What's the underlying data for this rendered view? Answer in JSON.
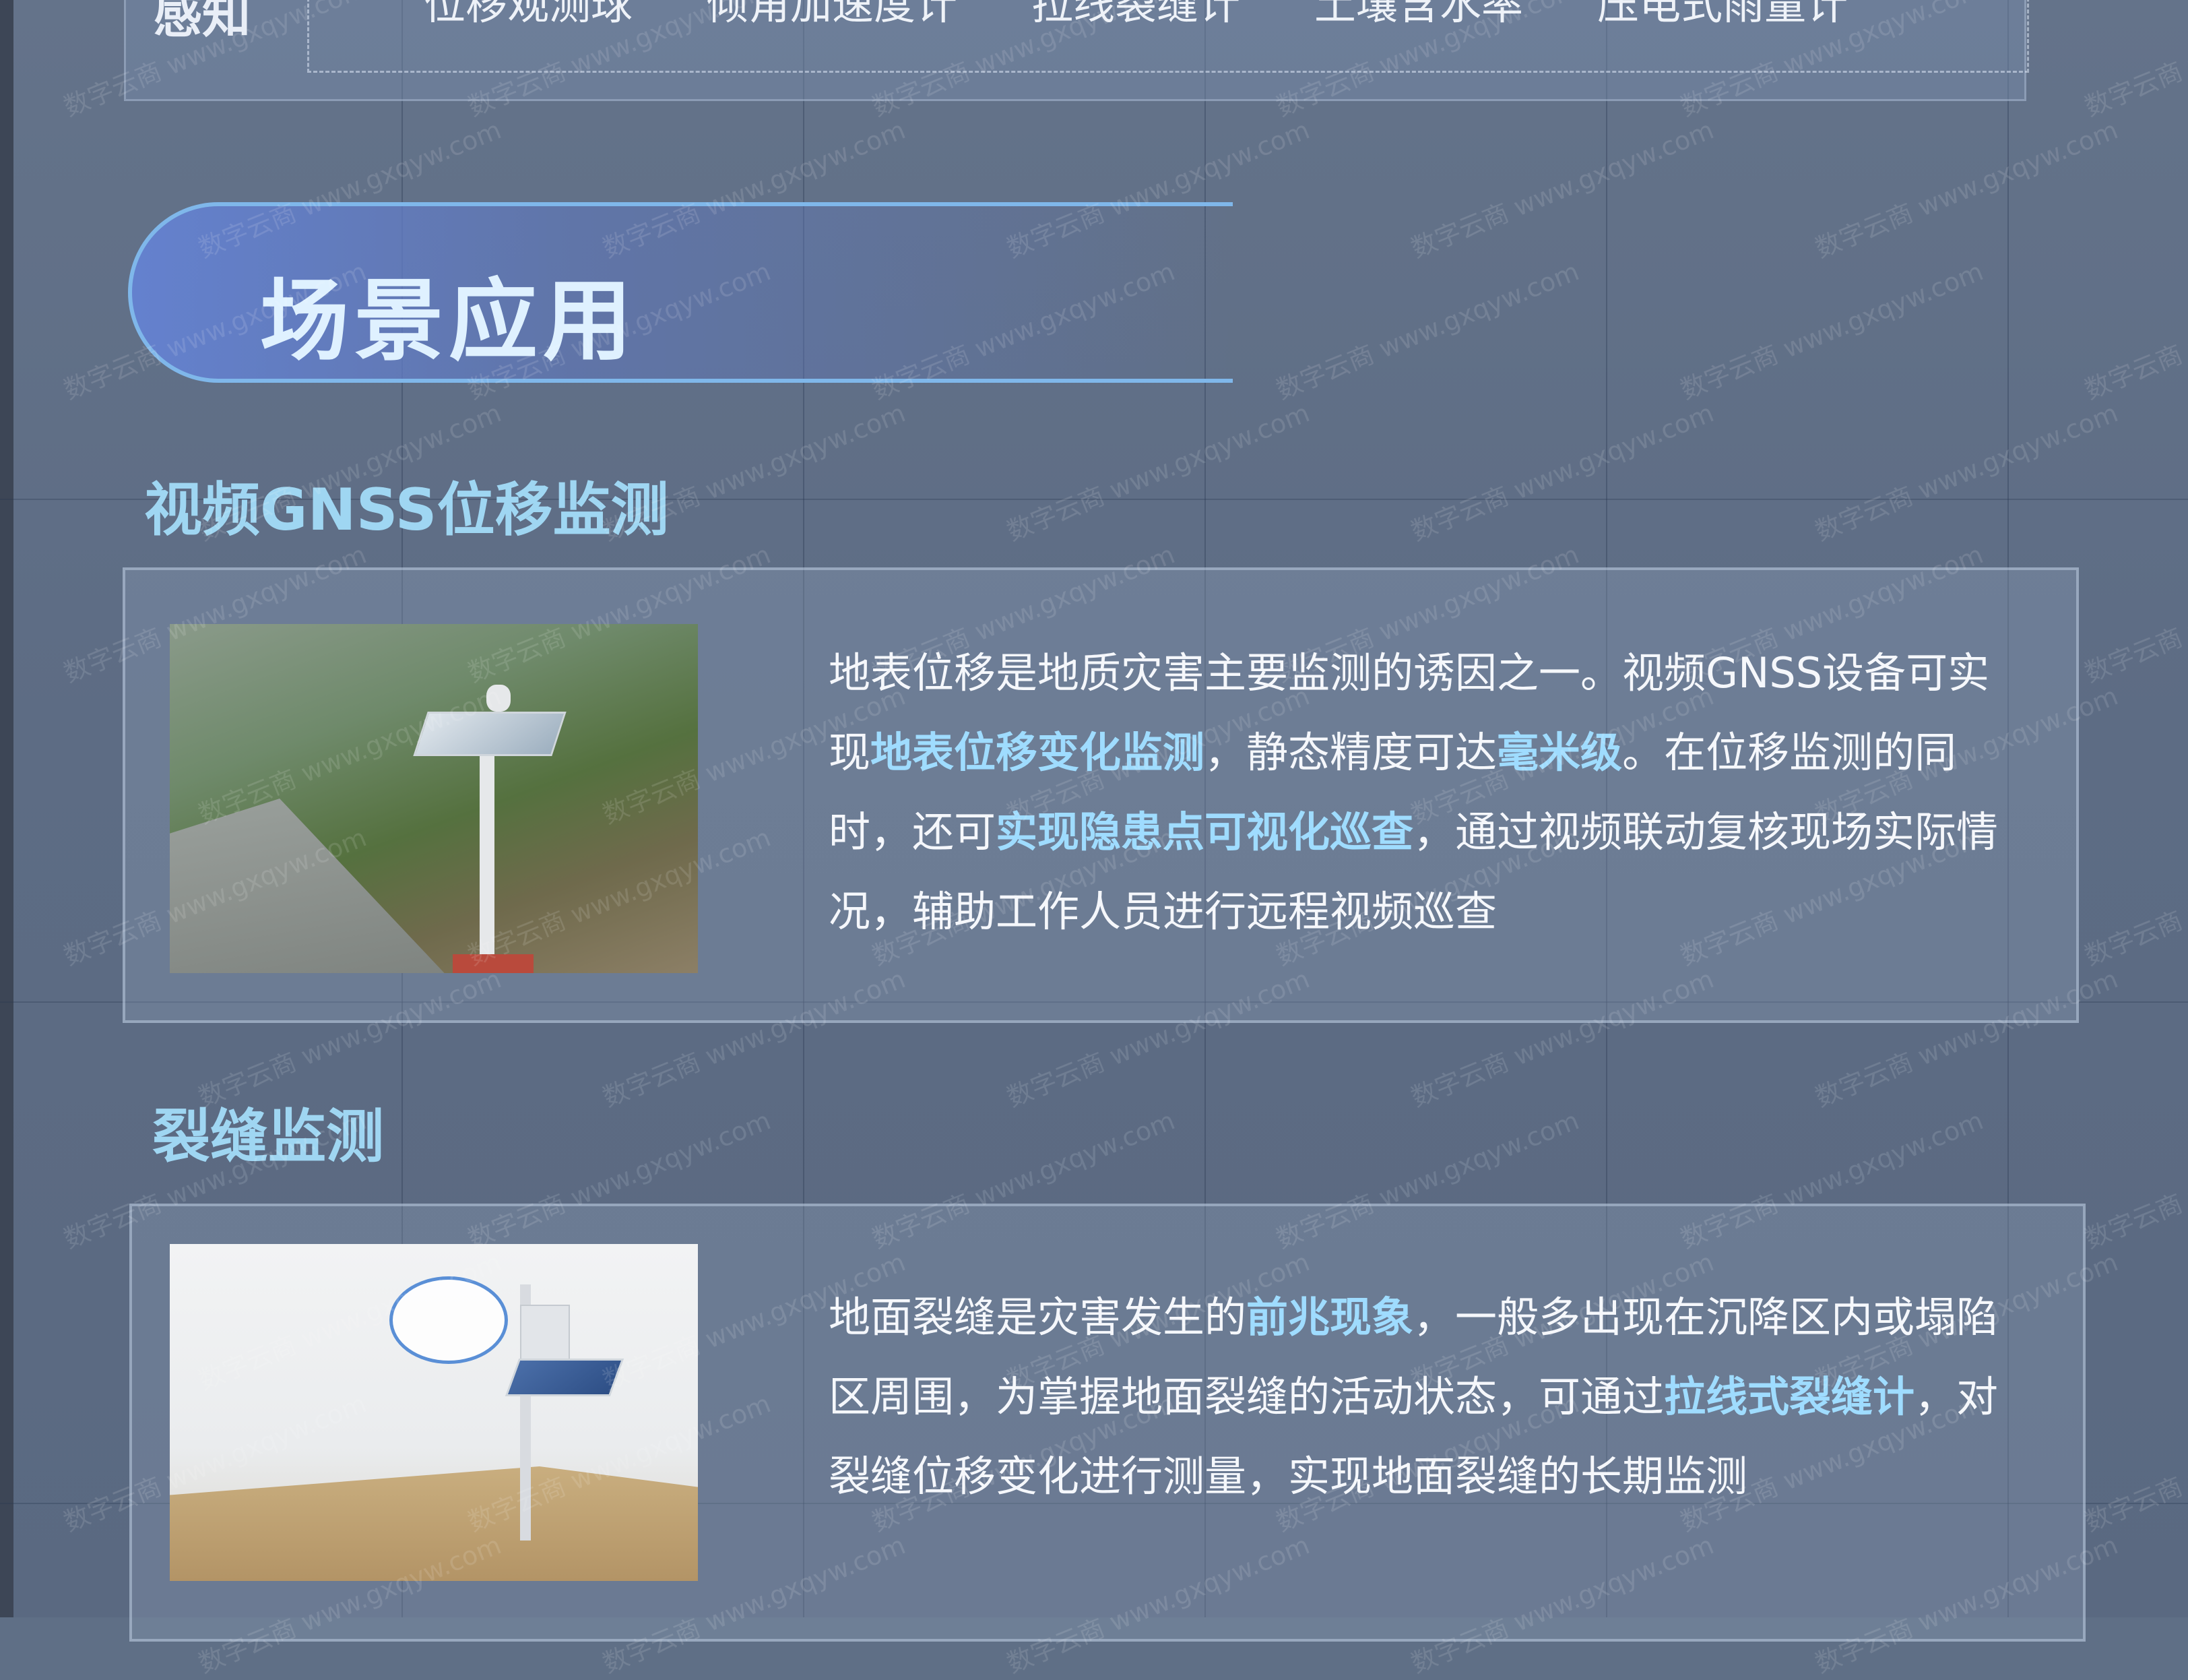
{
  "top_bar": {
    "label": "感知",
    "sensors": [
      "位移观测球",
      "倾角加速度计",
      "拉线裂缝计",
      "土壤含水率",
      "压电式雨量计"
    ]
  },
  "section": {
    "title": "场景应用"
  },
  "blocks": [
    {
      "heading": "视频GNSS位移监测",
      "segments": [
        {
          "t": "地表位移是地质灾害主要监测的诱因之一。视频GNSS设备可实现",
          "hl": false
        },
        {
          "t": "地表位移变化监测",
          "hl": true
        },
        {
          "t": "，静态精度可达",
          "hl": false
        },
        {
          "t": "毫米级",
          "hl": true
        },
        {
          "t": "。在位移监测的同时，还可",
          "hl": false
        },
        {
          "t": "实现隐患点可视化巡查",
          "hl": true
        },
        {
          "t": "，通过视频联动复核现场实际情况，辅助工作人员进行远程视频巡查",
          "hl": false
        }
      ]
    },
    {
      "heading": "裂缝监测",
      "segments": [
        {
          "t": "地面裂缝是灾害发生的",
          "hl": false
        },
        {
          "t": "前兆现象",
          "hl": true
        },
        {
          "t": "，一般多出现在沉降区内或塌陷区周围，为掌握地面裂缝的活动状态，可通过",
          "hl": false
        },
        {
          "t": "拉线式裂缝计",
          "hl": true
        },
        {
          "t": "，对裂缝位移变化进行测量，实现地面裂缝的长期监测",
          "hl": false
        }
      ]
    }
  ],
  "watermark": {
    "line1": "数字云商",
    "line2": "www.gxqyw.com"
  },
  "colors": {
    "highlight": "#9fdcff",
    "heading": "#9fd6f2",
    "background": "#5f6f86"
  }
}
